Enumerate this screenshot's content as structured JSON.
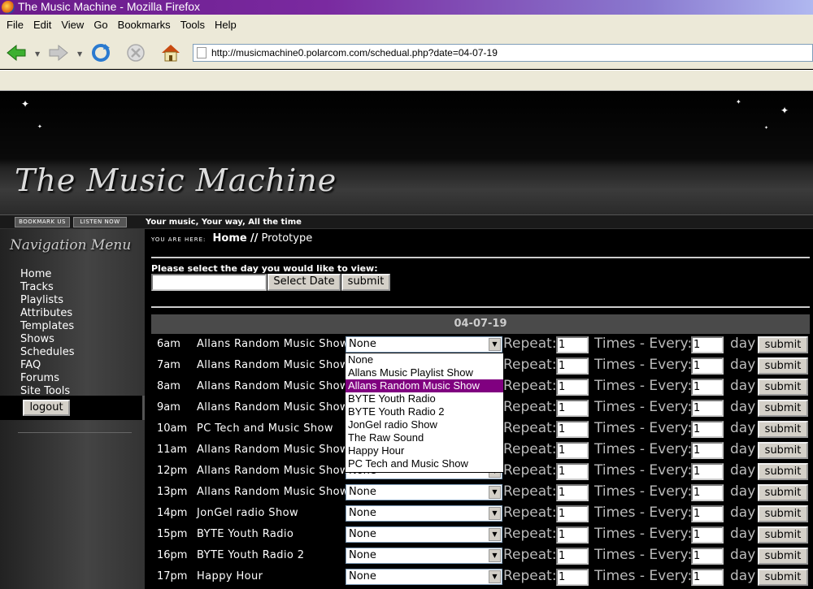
{
  "window": {
    "title": "The Music Machine - Mozilla Firefox"
  },
  "menu": [
    "File",
    "Edit",
    "View",
    "Go",
    "Bookmarks",
    "Tools",
    "Help"
  ],
  "browser": {
    "url": "http://musicmachine0.polarcom.com/schedual.php?date=04-07-19"
  },
  "site": {
    "logo": "The Music Machine",
    "bookmark_label": "BOOKMARK US",
    "listen_label": "LISTEN NOW",
    "tagline": "Your music, Your way, All the time"
  },
  "nav": {
    "title": "Navigation Menu",
    "items": [
      "Home",
      "Tracks",
      "Playlists",
      "Attributes",
      "Templates",
      "Shows",
      "Schedules",
      "FAQ",
      "Forums",
      "Site Tools"
    ],
    "logout": "logout"
  },
  "main": {
    "you_are_here": "YOU ARE HERE:",
    "crumb_home": "Home",
    "crumb_sep": "//",
    "crumb_current": "Prototype",
    "prompt": "Please select the day you would like to view:",
    "date_value": "",
    "select_date_btn": "Select Date",
    "submit_btn": "submit",
    "date_header": "04-07-19",
    "repeat_label": "Repeat:",
    "times_label": "Times - Every:",
    "day_label": "day",
    "row_submit": "submit",
    "rows": [
      {
        "time": "6am",
        "show": "Allans Random Music Show",
        "select": "None",
        "repeat": "1",
        "every": "1"
      },
      {
        "time": "7am",
        "show": "Allans Random Music Show",
        "select": "None",
        "repeat": "1",
        "every": "1"
      },
      {
        "time": "8am",
        "show": "Allans Random Music Show",
        "select": "None",
        "repeat": "1",
        "every": "1"
      },
      {
        "time": "9am",
        "show": "Allans Random Music Show",
        "select": "None",
        "repeat": "1",
        "every": "1"
      },
      {
        "time": "10am",
        "show": "PC Tech and Music Show",
        "select": "None",
        "repeat": "1",
        "every": "1"
      },
      {
        "time": "11am",
        "show": "Allans Random Music Show",
        "select": "None",
        "repeat": "1",
        "every": "1"
      },
      {
        "time": "12pm",
        "show": "Allans Random Music Show",
        "select": "None",
        "repeat": "1",
        "every": "1"
      },
      {
        "time": "13pm",
        "show": "Allans Random Music Show",
        "select": "None",
        "repeat": "1",
        "every": "1"
      },
      {
        "time": "14pm",
        "show": "JonGel radio Show",
        "select": "None",
        "repeat": "1",
        "every": "1"
      },
      {
        "time": "15pm",
        "show": "BYTE Youth Radio",
        "select": "None",
        "repeat": "1",
        "every": "1"
      },
      {
        "time": "16pm",
        "show": "BYTE Youth Radio 2",
        "select": "None",
        "repeat": "1",
        "every": "1"
      },
      {
        "time": "17pm",
        "show": "Happy Hour",
        "select": "None",
        "repeat": "1",
        "every": "1"
      }
    ],
    "dropdown_options": [
      "None",
      "Allans Music Playlist Show",
      "Allans Random Music Show",
      "BYTE Youth Radio",
      "BYTE Youth Radio 2",
      "JonGel radio Show",
      "The Raw Sound",
      "Happy Hour",
      "PC Tech and Music Show"
    ],
    "dropdown_highlight": "Allans Random Music Show"
  },
  "colors": {
    "highlight": "#800080",
    "title_bar": "#6a1a8a"
  }
}
